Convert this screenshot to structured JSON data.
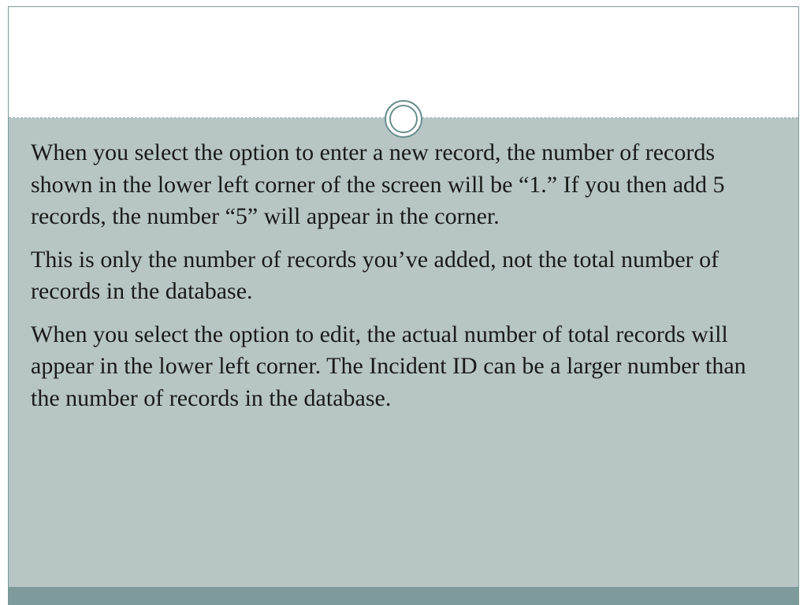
{
  "slide": {
    "paragraphs": [
      "When you select the option to enter a new record, the number of records shown in the lower left corner of the screen will be “1.” If you then add 5 records, the number “5” will appear in the corner.",
      "This is only the number of records you’ve added, not the total number of records in the database.",
      "When you select the option to edit, the actual number of total records will appear in the lower left corner. The Incident ID can be a larger number than the number of records in the database."
    ]
  }
}
